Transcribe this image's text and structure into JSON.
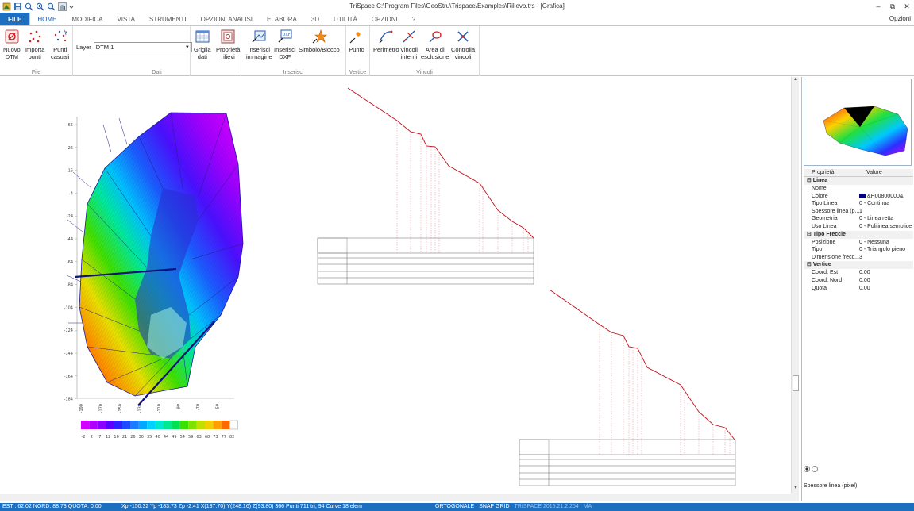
{
  "window": {
    "title": "TriSpace C:\\Program Files\\GeoStru\\Trispace\\Examples\\Rilievo.trs - [Grafica]",
    "opzioni": "Opzioni"
  },
  "tabs": [
    "FILE",
    "HOME",
    "MODIFICA",
    "VISTA",
    "STRUMENTI",
    "OPZIONI ANALISI",
    "ELABORA",
    "3D",
    "UTILITÀ",
    "OPZIONI",
    "?"
  ],
  "ribbon": {
    "groups": {
      "file": "File",
      "dati": "Dati",
      "inserisci": "Inserisci",
      "vertice": "Vertice",
      "vincoli": "Vincoli"
    },
    "buttons": {
      "nuovo_dtm": "Nuovo\nDTM",
      "importa_punti": "Importa\npunti",
      "punti_casuali": "Punti\ncasuali",
      "griglia_dati": "Griglia\ndati",
      "proprieta_rilievi": "Proprietà\nrilievi",
      "inserisci_immagine": "Inserisci\nimmagine",
      "inserisci_dxf": "Inserisci\nDXF",
      "simbolo_blocco": "Simbolo/Blocco",
      "punto": "Punto",
      "perimetro": "Perimetro",
      "vincoli_interni": "Vincoli\ninterni",
      "area_esclusione": "Area di\nesclusione",
      "controlla_vincoli": "Controlla\nvincoli"
    },
    "layer_label": "Layer",
    "layer_value": "DTM 1"
  },
  "plot": {
    "y_ticks": [
      "66",
      "26",
      "16",
      "-4",
      "-24",
      "-44",
      "-64",
      "-84",
      "-104",
      "-124",
      "-144",
      "-164",
      "-184"
    ],
    "x_ticks": [
      "-190",
      "-170",
      "-150",
      "-130",
      "-110",
      "-90",
      "-70",
      "-50"
    ],
    "legend_values": [
      "-2",
      "2",
      "7",
      "12",
      "16",
      "21",
      "26",
      "30",
      "35",
      "40",
      "44",
      "49",
      "54",
      "59",
      "63",
      "68",
      "73",
      "77",
      "82"
    ],
    "legend_colors": [
      "#d400ff",
      "#b000ff",
      "#8a00ff",
      "#5a00ff",
      "#2c22ff",
      "#1b4cff",
      "#1b7cff",
      "#00a8ff",
      "#00d0ff",
      "#00e8d0",
      "#00e890",
      "#00e050",
      "#3ce000",
      "#80e000",
      "#c0e000",
      "#f0d000",
      "#ffa000",
      "#ff6a00",
      "#ffffff"
    ]
  },
  "properties": {
    "header": {
      "key": "Proprietà",
      "value": "Valore"
    },
    "sections": [
      {
        "title": "Linea",
        "rows": [
          {
            "k": "Nome",
            "v": ""
          },
          {
            "k": "Colore",
            "v": "&H00800000&"
          },
          {
            "k": "Tipo Linea",
            "v": "0 - Continua"
          },
          {
            "k": "Spessore linea (p...",
            "v": "1"
          },
          {
            "k": "Geometria",
            "v": "0 - Linea retta"
          },
          {
            "k": "Uso Linea",
            "v": "0 - Polilinea semplice"
          }
        ]
      },
      {
        "title": "Tipo Freccie",
        "rows": [
          {
            "k": "Posizione",
            "v": "0 - Nessuna"
          },
          {
            "k": "Tipo",
            "v": "0 - Triangolo pieno"
          },
          {
            "k": "Dimensione frecc...",
            "v": "3"
          }
        ]
      },
      {
        "title": "Vertice",
        "rows": [
          {
            "k": "Coord. Est",
            "v": "0.00"
          },
          {
            "k": "Coord. Nord",
            "v": "0.00"
          },
          {
            "k": "Quota",
            "v": "0.00"
          }
        ]
      }
    ],
    "description": "Spessore linea (pixel)"
  },
  "status": {
    "coords": "EST : 62.02   NORD: 88.73   QUOTA: 0.00",
    "info": "Xp -150.32 Yp -183.73 Zp -2.41 X(137.70) Y(248.16) Z(93.80)  366 Punti 711 tri, 94 Curve 18 elem",
    "ortogonale": "ORTOGONALE",
    "snap": "SNAP GRID",
    "version": "TRISPACE 2015.21.2.254",
    "extra": "MA"
  },
  "colors": {
    "accent": "#1f6fc0",
    "profile_line": "#c0101a"
  }
}
